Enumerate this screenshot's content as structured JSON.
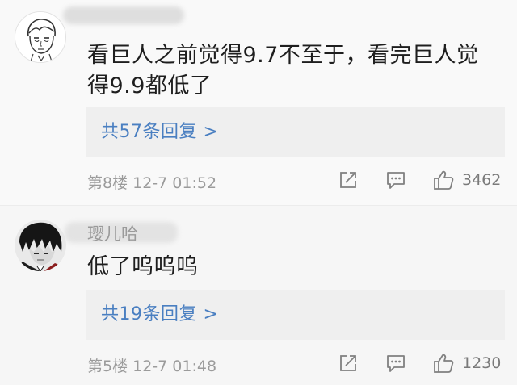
{
  "comments": [
    {
      "username": "",
      "text": "看巨人之前觉得9.7不至于，看完巨人觉得9.9都低了",
      "reply_link": "共57条回复 >",
      "meta": "第8楼 12-7 01:52",
      "like_count": "3462",
      "icons": [
        "share-icon",
        "comment-icon",
        "like-icon"
      ]
    },
    {
      "username": "璎儿哈",
      "text": "低了呜呜呜",
      "reply_link": "共19条回复 >",
      "meta": "第5楼 12-7 01:48",
      "like_count": "1230",
      "icons": [
        "share-icon",
        "comment-icon",
        "like-icon"
      ]
    }
  ],
  "colors": {
    "link": "#4a7fc1",
    "meta": "#9b9b9b",
    "reply_bg": "#efefef"
  }
}
